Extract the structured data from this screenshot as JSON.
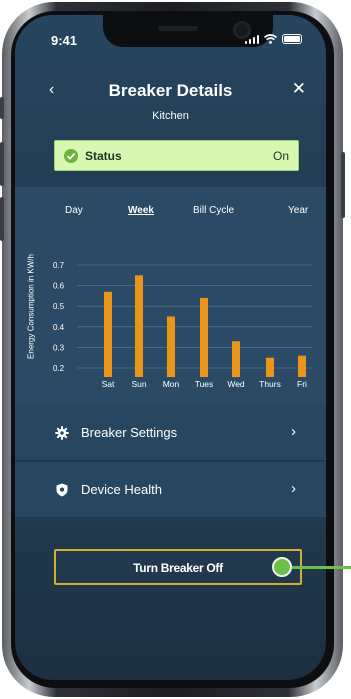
{
  "status_bar": {
    "time": "9:41"
  },
  "header": {
    "back_icon": "‹",
    "title": "Breaker Details",
    "subtitle": "Kitchen",
    "close_icon": "✕"
  },
  "status": {
    "label": "Status",
    "value": "On",
    "color": "#d9f7b2"
  },
  "tabs": [
    {
      "label": "Day",
      "active": false
    },
    {
      "label": "Week",
      "active": true
    },
    {
      "label": "Bill Cycle",
      "active": false
    },
    {
      "label": "Year",
      "active": false
    }
  ],
  "chart_data": {
    "type": "bar",
    "ylabel": "Energy Consumption in KW/h",
    "xlabel": "",
    "categories": [
      "Sat",
      "Sun",
      "Mon",
      "Tues",
      "Wed",
      "Thurs",
      "Fri"
    ],
    "values": [
      0.57,
      0.65,
      0.45,
      0.54,
      0.33,
      0.25,
      0.26
    ],
    "yticks": [
      "0.7",
      "0.6",
      "0.5",
      "0.4",
      "0.3",
      "0.2"
    ],
    "ylim": [
      0.15,
      0.7
    ],
    "bar_color": "#e8951a",
    "grid": true
  },
  "menu": [
    {
      "label": "Breaker Settings",
      "icon": "gear-icon"
    },
    {
      "label": "Device Health",
      "icon": "shield-icon"
    }
  ],
  "action_button": {
    "label": "Turn Breaker Off",
    "border_color": "#d0b031"
  },
  "callout": {
    "color": "#6cc04a"
  }
}
